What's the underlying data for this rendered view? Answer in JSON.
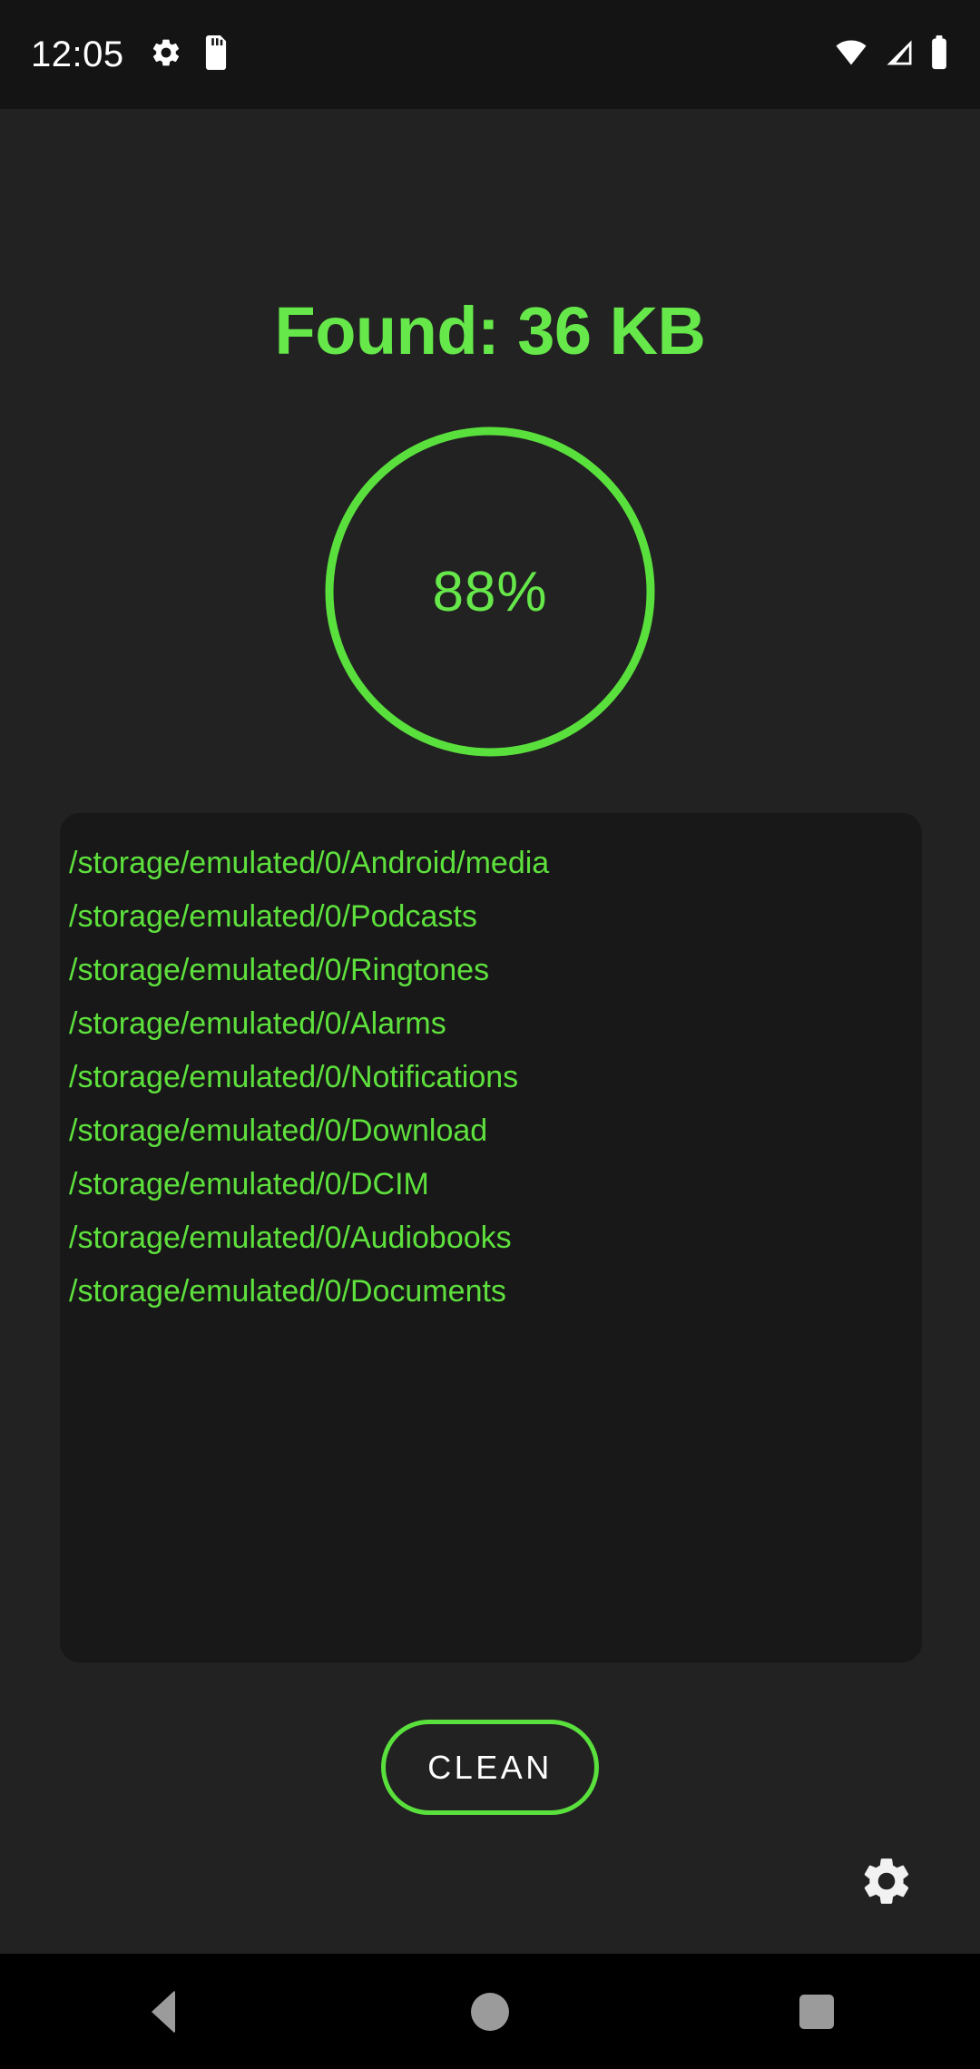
{
  "status_bar": {
    "clock": "12:05",
    "left_icons": [
      "gear-icon",
      "sd-card-icon"
    ],
    "right_icons": [
      "wifi-icon",
      "cellular-signal-icon",
      "battery-icon"
    ]
  },
  "header": {
    "found_label": "Found: 36 KB"
  },
  "progress": {
    "percent_label": "88%",
    "percent_value": 88,
    "ring_color": "#5ae03d"
  },
  "path_list": {
    "items": [
      "/storage/emulated/0/Android/media",
      "/storage/emulated/0/Podcasts",
      "/storage/emulated/0/Ringtones",
      "/storage/emulated/0/Alarms",
      "/storage/emulated/0/Notifications",
      "/storage/emulated/0/Download",
      "/storage/emulated/0/DCIM",
      "/storage/emulated/0/Audiobooks",
      "/storage/emulated/0/Documents"
    ]
  },
  "actions": {
    "clean_label": "CLEAN",
    "settings_icon": "gear-icon"
  },
  "nav_bar": {
    "back": "back-icon",
    "home": "home-icon",
    "recents": "recents-icon"
  },
  "colors": {
    "accent_green": "#5ae03d",
    "title_green": "#66e84a",
    "page_background": "#222222",
    "card_background": "#181818",
    "status_background": "#141414",
    "nav_background": "#000000"
  }
}
